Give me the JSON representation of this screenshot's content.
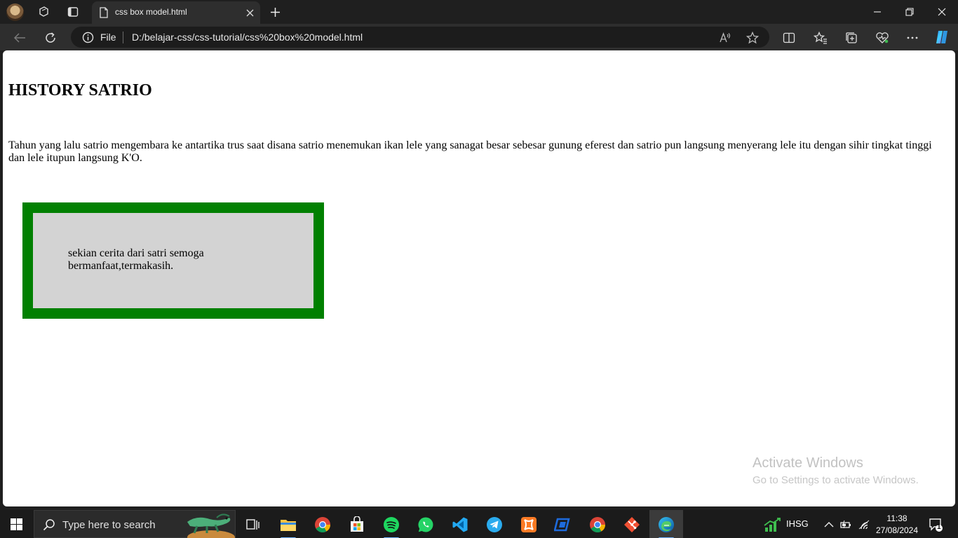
{
  "browser": {
    "tab_title": "css box model.html",
    "address": {
      "scheme_label": "File",
      "url": "D:/belajar-css/css-tutorial/css%20box%20model.html"
    }
  },
  "page": {
    "heading": "HISTORY SATRIO",
    "paragraph": "Tahun yang lalu satrio mengembara ke antartika trus saat disana satrio menemukan ikan lele yang sanagat besar sebesar gunung eferest dan satrio pun langsung menyerang lele itu dengan sihir tingkat tinggi dan lele itupun langsung K'O.",
    "box_text": "sekian cerita dari satri semoga bermanfaat,termakasih.",
    "colors": {
      "box_border": "#008000",
      "box_background": "#d3d3d3"
    }
  },
  "watermark": {
    "line1": "Activate Windows",
    "line2": "Go to Settings to activate Windows."
  },
  "taskbar": {
    "search_placeholder": "Type here to search",
    "apps": [
      "task-view",
      "file-explorer",
      "chrome",
      "microsoft-store",
      "spotify",
      "whatsapp",
      "vscode",
      "telegram",
      "xampp",
      "anydesk",
      "chrome",
      "git",
      "edge"
    ],
    "tray_label": "IHSG",
    "time": "11:38",
    "date": "27/08/2024",
    "notification_count": "1"
  }
}
